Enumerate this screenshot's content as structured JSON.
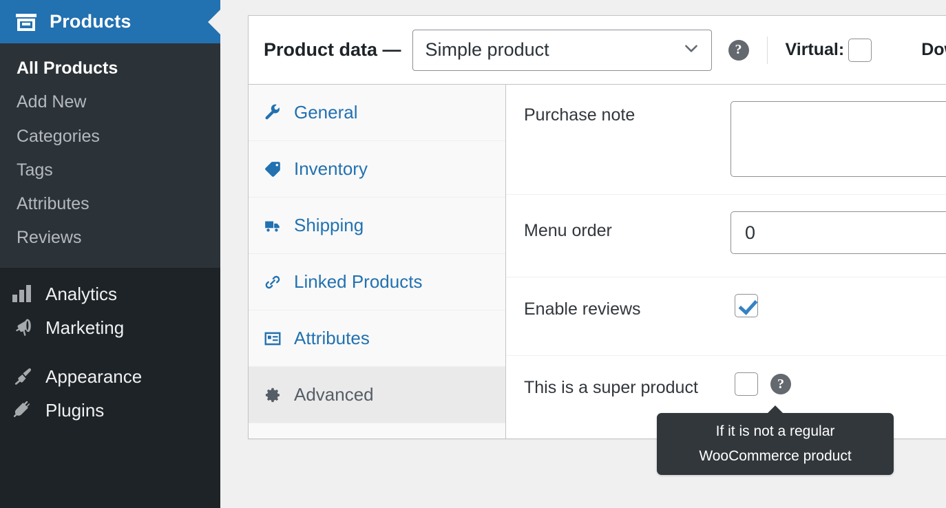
{
  "sidebar": {
    "current_menu": {
      "label": "Products",
      "icon": "products-box-icon"
    },
    "submenu": [
      {
        "label": "All Products",
        "current": true
      },
      {
        "label": "Add New",
        "current": false
      },
      {
        "label": "Categories",
        "current": false
      },
      {
        "label": "Tags",
        "current": false
      },
      {
        "label": "Attributes",
        "current": false
      },
      {
        "label": "Reviews",
        "current": false
      }
    ],
    "menu": [
      {
        "label": "Analytics",
        "icon": "analytics-bars-icon"
      },
      {
        "label": "Marketing",
        "icon": "megaphone-icon"
      },
      {
        "label": "Appearance",
        "icon": "paintbrush-icon"
      },
      {
        "label": "Plugins",
        "icon": "plug-icon"
      }
    ]
  },
  "panel": {
    "title": "Product data —",
    "product_type": {
      "value": "Simple product",
      "icon": "chevron-down-icon"
    },
    "help_icon": "question-mark-icon",
    "options": [
      {
        "label": "Virtual:",
        "checked": false
      },
      {
        "label": "Down",
        "checked": false
      }
    ],
    "tabs": [
      {
        "label": "General",
        "icon": "wrench-icon",
        "active": false
      },
      {
        "label": "Inventory",
        "icon": "tag-icon",
        "active": false
      },
      {
        "label": "Shipping",
        "icon": "truck-icon",
        "active": false
      },
      {
        "label": "Linked Products",
        "icon": "link-icon",
        "active": false
      },
      {
        "label": "Attributes",
        "icon": "list-card-icon",
        "active": false
      },
      {
        "label": "Advanced",
        "icon": "gear-icon",
        "active": true
      }
    ],
    "fields": {
      "purchase_note": {
        "label": "Purchase note",
        "value": ""
      },
      "menu_order": {
        "label": "Menu order",
        "value": "0"
      },
      "enable_reviews": {
        "label": "Enable reviews",
        "checked": true
      },
      "super_product": {
        "label": "This is a super product",
        "checked": false,
        "help_icon": "question-mark-icon"
      }
    }
  },
  "tooltip": {
    "line1": "If it is not a regular",
    "line2": "WooCommerce product"
  },
  "colors": {
    "accent_blue": "#2271b1",
    "sidebar_dark": "#1d2327",
    "submenu_dark": "#2c3338",
    "page_bg": "#f0f0f1",
    "tooltip_bg": "#32373c"
  }
}
